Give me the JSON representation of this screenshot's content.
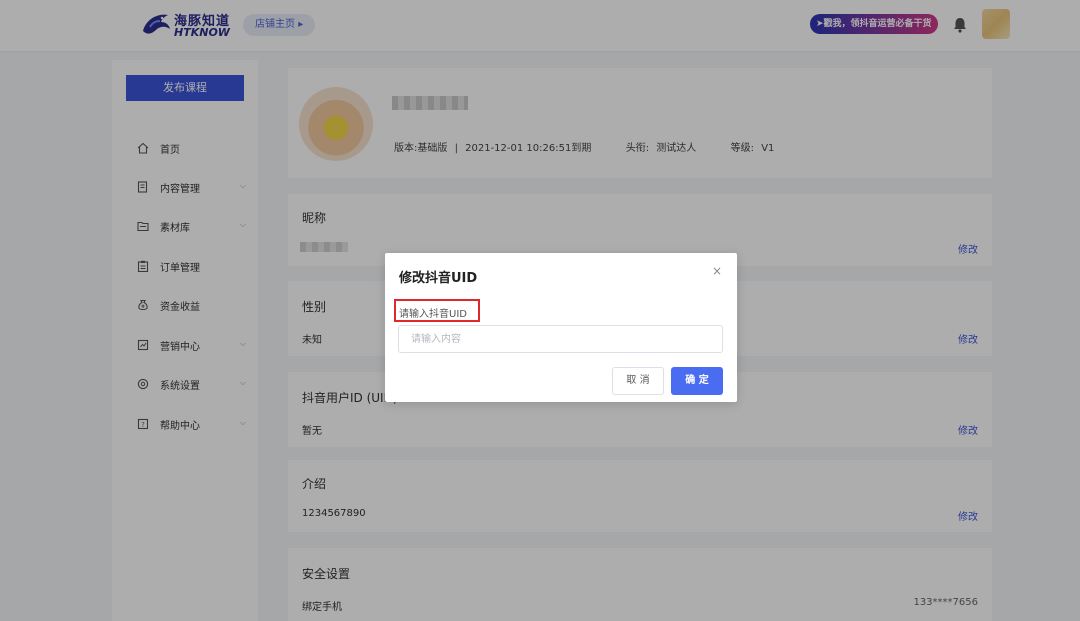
{
  "header": {
    "logo_cn": "海豚知道",
    "logo_en": "HTKNOW",
    "store_home": "店铺主页",
    "promo_text": "戳我，领抖音运营必备干货",
    "logo_color": "#2c2f8f",
    "accent": "#3b55d9"
  },
  "sidebar": {
    "publish_label": "发布课程",
    "items": [
      {
        "label": "首页",
        "icon": "home-icon",
        "has_submenu": false
      },
      {
        "label": "内容管理",
        "icon": "content-icon",
        "has_submenu": true
      },
      {
        "label": "素材库",
        "icon": "folder-icon",
        "has_submenu": true
      },
      {
        "label": "订单管理",
        "icon": "clipboard-icon",
        "has_submenu": false
      },
      {
        "label": "资金收益",
        "icon": "money-icon",
        "has_submenu": false
      },
      {
        "label": "营销中心",
        "icon": "marketing-icon",
        "has_submenu": true
      },
      {
        "label": "系统设置",
        "icon": "gear-icon",
        "has_submenu": true
      },
      {
        "label": "帮助中心",
        "icon": "help-icon",
        "has_submenu": true
      }
    ]
  },
  "profile": {
    "version": "版本:基础版",
    "separator": "|",
    "expiry": "2021-12-01 10:26:51到期",
    "title_label": "头衔:",
    "title_value": "测试达人",
    "level_label": "等级:",
    "level_value": "V1"
  },
  "fields": {
    "nickname": {
      "title": "昵称",
      "edit": "修改"
    },
    "gender": {
      "title": "性别",
      "value": "未知",
      "edit": "修改"
    },
    "douyin_id": {
      "title": "抖音用户ID (UID)",
      "value": "暂无",
      "edit": "修改"
    },
    "intro": {
      "title": "介绍",
      "value": "1234567890",
      "edit": "修改"
    },
    "security": {
      "title": "安全设置",
      "phone_label": "绑定手机",
      "phone_value": "133****7656"
    }
  },
  "dialog": {
    "title": "修改抖音UID",
    "close": "×",
    "label": "请输入抖音UID",
    "input_placeholder": "请输入内容",
    "input_value": "",
    "cancel": "取 消",
    "confirm": "确 定",
    "highlight_color": "#e0282b"
  }
}
